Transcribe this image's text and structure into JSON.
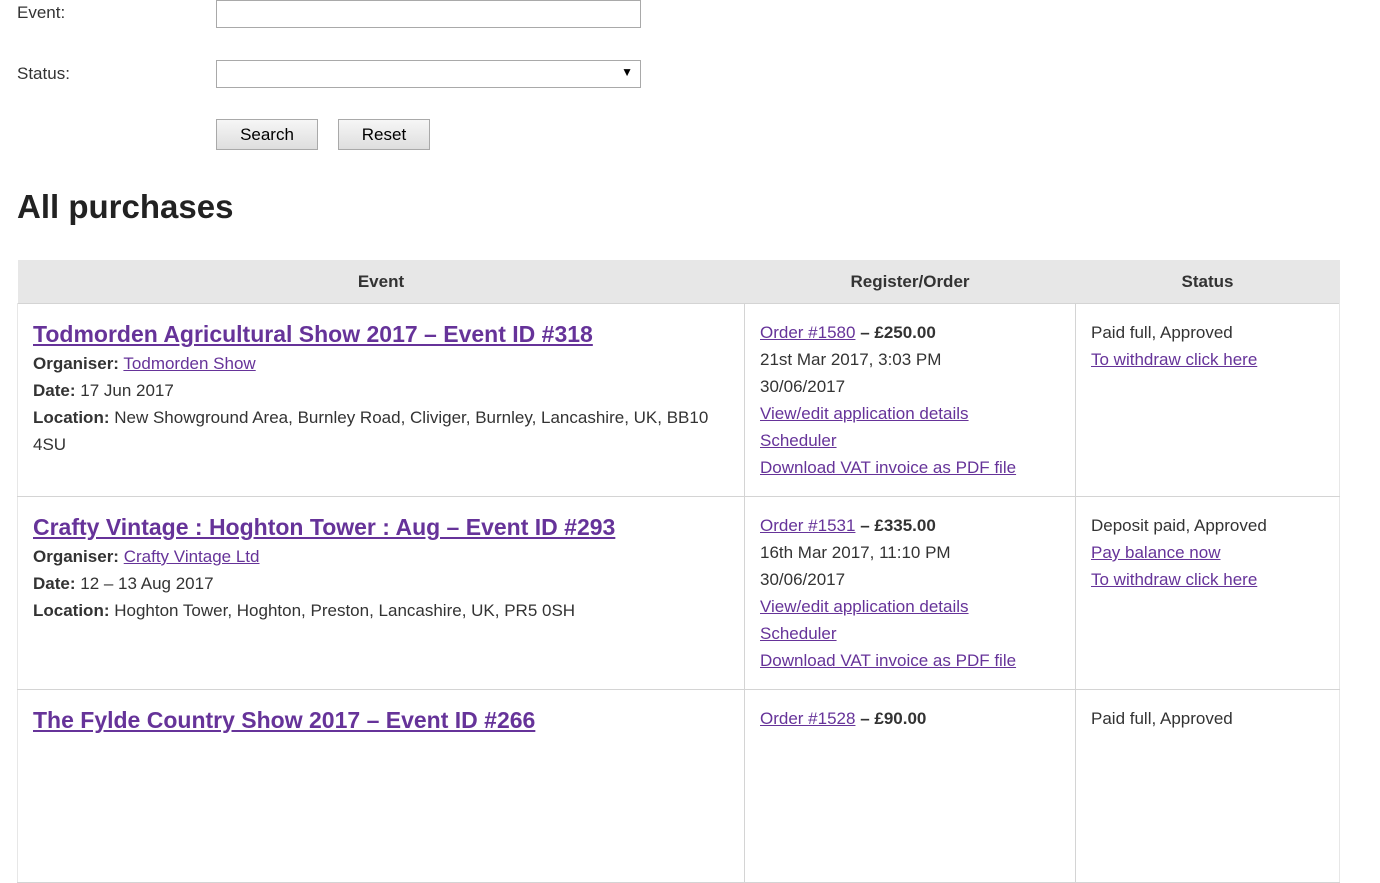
{
  "filters": {
    "event_label": "Event:",
    "event_value": "",
    "status_label": "Status:",
    "status_value": "",
    "search_label": "Search",
    "reset_label": "Reset"
  },
  "heading": "All purchases",
  "table": {
    "headers": [
      "Event",
      "Register/Order",
      "Status"
    ],
    "rows": [
      {
        "title": "Todmorden Agricultural Show 2017 – Event ID #318",
        "organiser_label": "Organiser:",
        "organiser": "Todmorden Show",
        "date_label": "Date:",
        "date": "17 Jun 2017",
        "location_label": "Location:",
        "location": "New Showground Area, Burnley Road, Cliviger, Burnley, Lancashire, UK, BB10 4SU",
        "order_link": "Order #1580",
        "order_amount": "– £250.00",
        "order_datetime": "21st Mar 2017, 3:03 PM",
        "order_date2": "30/06/2017",
        "view_edit": "View/edit application details",
        "scheduler": "Scheduler",
        "vat_invoice": "Download VAT invoice as PDF file",
        "status_text": "Paid full, Approved",
        "pay_balance": "",
        "withdraw": "To withdraw click here"
      },
      {
        "title": "Crafty Vintage : Hoghton Tower : Aug – Event ID #293",
        "organiser_label": "Organiser:",
        "organiser": "Crafty Vintage Ltd",
        "date_label": "Date:",
        "date": "12 – 13 Aug 2017",
        "location_label": "Location:",
        "location": "Hoghton Tower, Hoghton, Preston, Lancashire, UK, PR5 0SH",
        "order_link": "Order #1531",
        "order_amount": "– £335.00",
        "order_datetime": "16th Mar 2017, 11:10 PM",
        "order_date2": "30/06/2017",
        "view_edit": "View/edit application details",
        "scheduler": "Scheduler",
        "vat_invoice": "Download VAT invoice as PDF file",
        "status_text": "Deposit paid, Approved",
        "pay_balance": "Pay balance now",
        "withdraw": "To withdraw click here"
      },
      {
        "title": "The Fylde Country Show 2017 – Event ID #266",
        "order_link": "Order #1528",
        "order_amount": "– £90.00",
        "status_text": "Paid full, Approved"
      }
    ]
  }
}
